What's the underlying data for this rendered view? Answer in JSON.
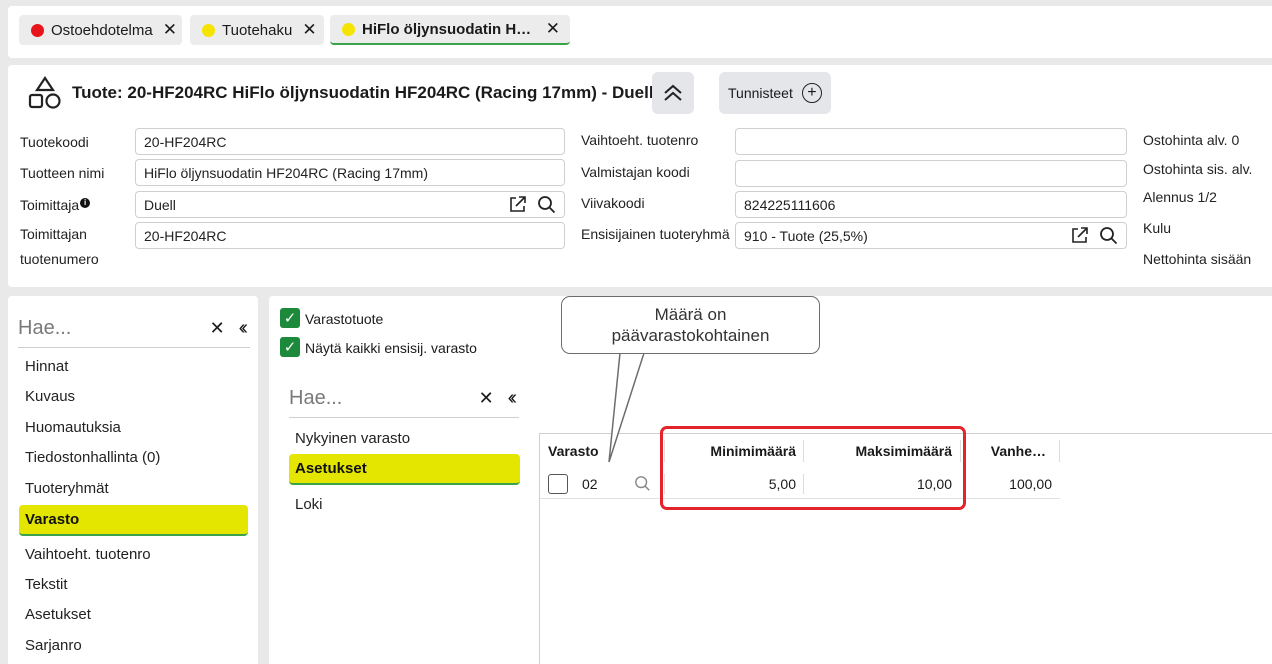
{
  "tabs": [
    {
      "label": "Ostoehdotelma",
      "dot": "#e8141c"
    },
    {
      "label": "Tuotehaku",
      "dot": "#f5e400"
    },
    {
      "label": "HiFlo öljynsuodatin H…",
      "dot": "#f5e400"
    }
  ],
  "header": {
    "title": "Tuote: 20-HF204RC HiFlo öljynsuodatin HF204RC (Racing 17mm) - Duell",
    "tags_label": "Tunnisteet",
    "fields": {
      "tuotekoodi": {
        "label": "Tuotekoodi",
        "value": "20-HF204RC"
      },
      "tuotteen_nimi": {
        "label": "Tuotteen nimi",
        "value": "HiFlo öljynsuodatin HF204RC (Racing 17mm)"
      },
      "toimittaja": {
        "label": "Toimittaja",
        "value": "Duell"
      },
      "toimittajan_tuotenumero": {
        "label_line1": "Toimittajan",
        "label_line2": "tuotenumero",
        "value": "20-HF204RC"
      },
      "vaihtoeht_tuotenro": {
        "label": "Vaihtoeht. tuotenro",
        "value": ""
      },
      "valmistajan_koodi": {
        "label": "Valmistajan koodi",
        "value": ""
      },
      "viivakoodi": {
        "label": "Viivakoodi",
        "value": "824225111606"
      },
      "ensisijainen_tuoteryhma": {
        "label": "Ensisijainen tuoteryhmä",
        "value": "910 - Tuote (25,5%)"
      }
    },
    "right_labels": [
      "Ostohinta alv. 0",
      "Ostohinta sis. alv.",
      "Alennus 1/2",
      "Kulu",
      "Nettohinta sisään"
    ]
  },
  "leftnav": {
    "search_placeholder": "Hae...",
    "items": [
      "Hinnat",
      "Kuvaus",
      "Huomautuksia",
      "Tiedostonhallinta (0)",
      "Tuoteryhmät",
      "Varasto",
      "Vaihtoeht. tuotenro",
      "Tekstit",
      "Asetukset",
      "Sarjanro"
    ],
    "selected": "Varasto"
  },
  "main": {
    "checkboxes": [
      {
        "label": "Varastotuote",
        "checked": true
      },
      {
        "label": "Näytä kaikki ensisij. varasto",
        "checked": true
      }
    ],
    "subnav": {
      "search_placeholder": "Hae...",
      "items": [
        "Nykyinen varasto",
        "Asetukset",
        "Loki"
      ],
      "selected": "Asetukset"
    },
    "grid": {
      "columns": [
        "Varasto",
        "Minimimäärä",
        "Maksimimäärä",
        "Vanhe…"
      ],
      "rows": [
        {
          "varasto": "02",
          "minimi": "5,00",
          "maksimi": "10,00",
          "vanhe": "100,00"
        }
      ]
    },
    "callout": {
      "line1": "Määrä on",
      "line2": "päävarastokohtainen"
    }
  },
  "colors": {
    "highlight": "#e4e600",
    "accent_green": "#3aa34a",
    "checkbox_green": "#1d8a3b",
    "annotation_red": "#e3242b"
  }
}
